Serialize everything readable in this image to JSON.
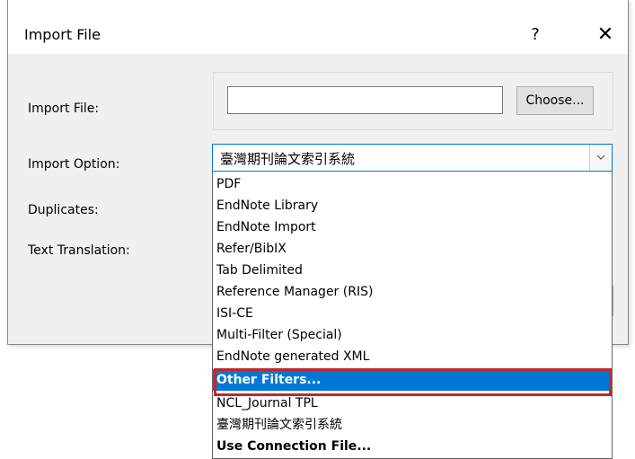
{
  "dialog": {
    "title": "Import File",
    "help_label": "?",
    "close_label": "✕",
    "labels": {
      "import_file": "Import File:",
      "import_option": "Import Option:",
      "duplicates": "Duplicates:",
      "text_translation": "Text Translation:"
    },
    "file_input": {
      "value": "",
      "placeholder": ""
    },
    "choose_label": "Choose...",
    "import_option": {
      "selected": "臺灣期刊論文索引系統",
      "options": [
        "PDF",
        "EndNote Library",
        "EndNote Import",
        "Refer/BibIX",
        "Tab Delimited",
        "Reference Manager (RIS)",
        "ISI-CE",
        "Multi-Filter (Special)",
        "EndNote generated XML",
        "Other Filters...",
        "NCL_Journal TPL",
        "臺灣期刊論文索引系統",
        "Use Connection File..."
      ],
      "highlighted": "Other Filters..."
    }
  },
  "colors": {
    "selection": "#0078d7",
    "annotation_border": "#c0272d"
  }
}
